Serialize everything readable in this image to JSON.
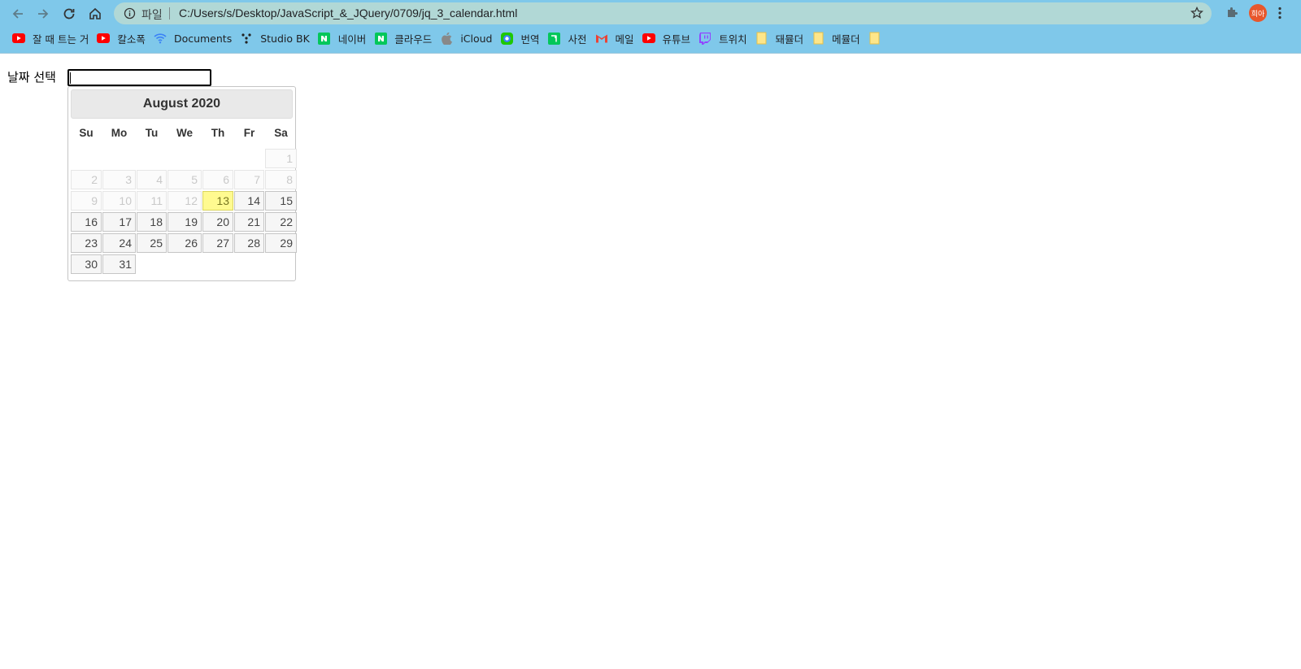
{
  "browser": {
    "scheme_label": "파일",
    "url": "C:/Users/s/Desktop/JavaScript_&_JQuery/0709/jq_3_calendar.html",
    "avatar_text": "희아",
    "bookmarks": [
      {
        "label": "잘 때 트는 거",
        "icon": "youtube-icon"
      },
      {
        "label": "칼소폭",
        "icon": "youtube-icon"
      },
      {
        "label": "Documents",
        "icon": "wifi-icon"
      },
      {
        "label": "Studio BK",
        "icon": "dots-icon"
      },
      {
        "label": "네이버",
        "icon": "naver-icon"
      },
      {
        "label": "클라우드",
        "icon": "naver-icon"
      },
      {
        "label": "iCloud",
        "icon": "apple-icon"
      },
      {
        "label": "번역",
        "icon": "papago-icon"
      },
      {
        "label": "사전",
        "icon": "dictionary-icon"
      },
      {
        "label": "메일",
        "icon": "gmail-icon"
      },
      {
        "label": "유튜브",
        "icon": "youtube-icon"
      },
      {
        "label": "트위치",
        "icon": "twitch-icon"
      },
      {
        "label": "돼뮬더",
        "icon": "folder-icon"
      },
      {
        "label": "메뮬더",
        "icon": "folder-icon"
      },
      {
        "label": "",
        "icon": "folder-icon"
      }
    ]
  },
  "page": {
    "label": "날짜 선택",
    "input_value": ""
  },
  "datepicker": {
    "title": "August 2020",
    "weekdays": [
      "Su",
      "Mo",
      "Tu",
      "We",
      "Th",
      "Fr",
      "Sa"
    ],
    "first_weekday_index": 6,
    "days_in_month": 31,
    "disabled_through": 12,
    "today": 13,
    "colors": {
      "today_bg": "#fffa90",
      "default_bg": "#f6f6f6"
    }
  }
}
